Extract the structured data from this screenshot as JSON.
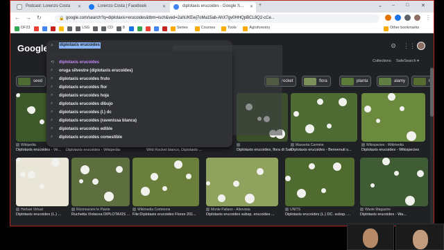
{
  "tabs": [
    {
      "title": "Podcast: Lorenzo Costa",
      "fav_color": "#e8eaed"
    },
    {
      "title": "Lorenzo Costa | Facebook",
      "fav_color": "#1877f2"
    },
    {
      "title": "diplotaxis erucoides - Google S...",
      "fav_color": "#4285f4"
    }
  ],
  "window_controls": [
    "⌄",
    "–",
    "□",
    "✕"
  ],
  "address_bar": {
    "url": "google.com/search?q=diplotaxis+erucoides&tbm=isch&ved=2ahUKEwj7oMa15ab-AhX7gv0HHQpBCL8Q2-cCe..."
  },
  "bookmarks": [
    {
      "label": "DF23",
      "color": "#34a853"
    },
    {
      "label": "",
      "color": "#ea4335"
    },
    {
      "label": "",
      "color": "#4285f4"
    },
    {
      "label": "",
      "color": "#c5221f"
    },
    {
      "label": "",
      "color": "#fbbc04"
    },
    {
      "label": "",
      "color": "#5f6368"
    },
    {
      "label": "LSG",
      "color": "#5f6368"
    },
    {
      "label": "",
      "color": "#5f6368"
    },
    {
      "label": "CD",
      "color": "#5f6368"
    },
    {
      "label": "8",
      "color": "#5f6368"
    },
    {
      "label": "",
      "color": "#1a73e8"
    },
    {
      "label": "",
      "color": "#34a853"
    },
    {
      "label": "",
      "color": "#ea4335"
    },
    {
      "label": "",
      "color": "#4285f4"
    },
    {
      "label": "",
      "color": "#c5221f"
    },
    {
      "label": "Series",
      "color": "#f9ab00"
    },
    {
      "label": "Courses",
      "color": "#f9ab00"
    },
    {
      "label": "Tools",
      "color": "#f9ab00"
    },
    {
      "label": "Agroforestry",
      "color": "#f9ab00"
    },
    {
      "label": "Other bookmarks",
      "color": "#f9ab00"
    }
  ],
  "google": {
    "logo": "Google",
    "query": "diplotaxis erucoides",
    "collections_label": "Collections",
    "safesearch_label": "SafeSearch"
  },
  "suggestions": [
    {
      "bold": "diplotaxis erucoides",
      "rest": "",
      "visited": true
    },
    {
      "bold": "oruga silvestre (diplotaxis erucoides)",
      "rest": "",
      "visited": false
    },
    {
      "bold": "diplotaxis erucoides ",
      "rest": "fruto",
      "visited": false
    },
    {
      "bold": "diplotaxis erucoides ",
      "rest": "flor",
      "visited": false
    },
    {
      "bold": "diplotaxis erucoides ",
      "rest": "hoja",
      "visited": false
    },
    {
      "bold": "diplotaxis erucoides ",
      "rest": "dibujo",
      "visited": false
    },
    {
      "bold": "diplotaxis erucoides ",
      "rest": "(l.) dc",
      "visited": false
    },
    {
      "bold": "diplotaxis erucoides ",
      "rest": "(ravenissa blanca)",
      "visited": false
    },
    {
      "bold": "diplotaxis erucoides ",
      "rest": "edible",
      "visited": false
    },
    {
      "bold": "diplotaxis erucoides ",
      "rest": "comestible",
      "visited": false
    }
  ],
  "chips": [
    {
      "label": "seed",
      "color": "#4e6b34"
    },
    {
      "label": "rocket",
      "color": "#6a7d45"
    },
    {
      "label": "flora",
      "color": "#7b8f5a"
    },
    {
      "label": "planta",
      "color": "#5b7a3a"
    },
    {
      "label": "alamy",
      "color": "#607d44"
    },
    {
      "label": "I dc",
      "color": "#556b2f"
    }
  ],
  "results_row1": [
    {
      "source": "Wikipedia",
      "title": "Diplotaxis erucoides - Wi...",
      "bg": "#3f5a2a"
    },
    {
      "source": "",
      "title": "Diplotaxis erucoides - Wikipedia",
      "bg": "#4a6330"
    },
    {
      "source": "",
      "title": "Wild Rocket bianco, Diplotaxis ...",
      "bg": "#55703a"
    },
    {
      "source": "",
      "title": "Diplotaxis erucoides, flora di Sardegna",
      "bg": "#3b4f2a"
    },
    {
      "source": "Masseria Carmine",
      "title": "Diplotaxis erucoides - Benvenuti s...",
      "bg": "#4d6b33"
    },
    {
      "source": "Wikispecies - Wikimedia",
      "title": "Diplotaxis erucoides - Wikispecies",
      "bg": "#6c8a3e"
    }
  ],
  "results_row2": [
    {
      "source": "Herbari Virtual",
      "title": "Diplotaxis erucoides (L.) ...",
      "bg": "#e9e6d8"
    },
    {
      "source": "Riconoscere le Piante",
      "title": "Ruchetta Violacea DIPLOTAXIS ...",
      "bg": "#5d6e3f"
    },
    {
      "source": "Wikimedia Commons",
      "title": "File:Diplotaxis erucoides Flores 201...",
      "bg": "#6b7f3d"
    },
    {
      "source": "Monte Pallano - Altervista",
      "title": "Diplotaxis erucoides subsp. erucoides ...",
      "bg": "#8fa35f"
    },
    {
      "source": "UNITS",
      "title": "Diplotaxis erucoides (L.) DC. subsp. ...",
      "bg": "#4f6b2f"
    },
    {
      "source": "Waste Magazine",
      "title": "Diplotaxis erucoides - Wa...",
      "bg": "#3f5c35"
    }
  ]
}
